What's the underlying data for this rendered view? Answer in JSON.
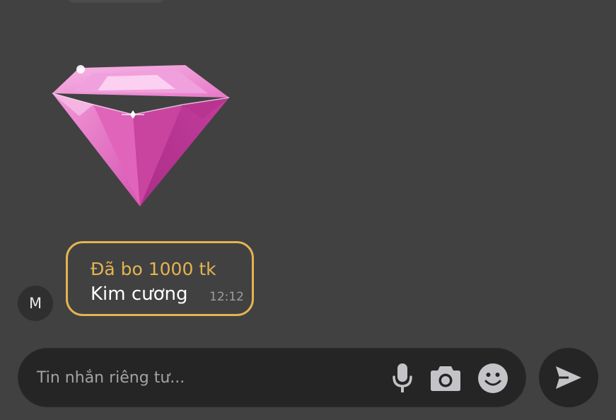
{
  "colors": {
    "background": "#414142",
    "accent_gold": "#e3b450",
    "input_bg": "#252526",
    "icon_gray": "#c4c4c8"
  },
  "message": {
    "avatar_initial": "M",
    "sticker_icon": "pink-diamond-sticker",
    "title": "Đã bo 1000 tk",
    "text": "Kim cương",
    "time": "12:12"
  },
  "composer": {
    "placeholder": "Tin nhắn riêng tư...",
    "value": "",
    "icons": [
      "microphone-icon",
      "camera-icon",
      "emoji-icon",
      "send-icon"
    ]
  }
}
